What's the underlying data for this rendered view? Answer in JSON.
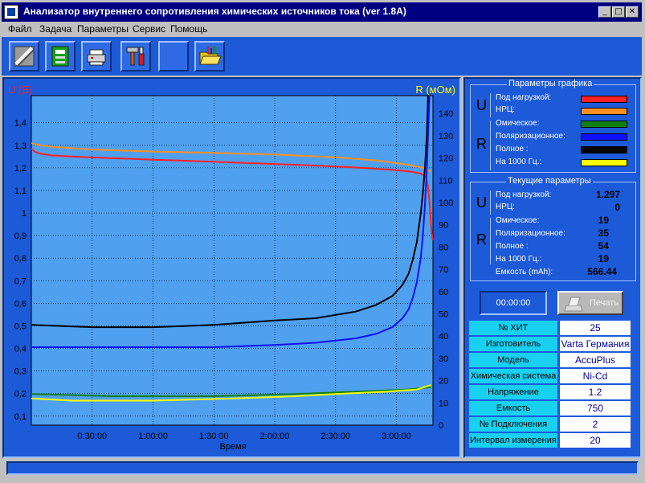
{
  "window": {
    "title": "Анализатор внутреннего сопротивления химических источников тока (ver 1.8A)"
  },
  "menu": [
    "Файл",
    "Задача",
    "Параметры",
    "Сервис",
    "Помощь"
  ],
  "toolbar_icons": [
    "battery-tool-icon",
    "circuit-board-icon",
    "printer-setup-icon",
    "tools-icon",
    "blank-tool-icon",
    "open-folder-icon"
  ],
  "chart_data": {
    "type": "line",
    "y1label": "U (В)",
    "y2label": "R (мОм)",
    "xlabel": "Время",
    "x_ticks": [
      "0:30:00",
      "1:00:00",
      "1:30:00",
      "2:00:00",
      "2:30:00",
      "3:00:00"
    ],
    "y1_ticks": [
      "0,1",
      "0,2",
      "0,3",
      "0,4",
      "0,5",
      "0,6",
      "0,7",
      "0,8",
      "0,9",
      "1",
      "1,1",
      "1,2",
      "1,3",
      "1,4"
    ],
    "y2_ticks": [
      "0",
      "10",
      "20",
      "30",
      "40",
      "50",
      "60",
      "70",
      "80",
      "90",
      "100",
      "110",
      "120",
      "130",
      "140"
    ],
    "x_unit": "minutes",
    "x_range": [
      0,
      198
    ],
    "y1_range": [
      0.06,
      1.52
    ],
    "y2_range": [
      0,
      148
    ],
    "grid": true,
    "series": [
      {
        "color": "#ff2020",
        "axis": "left",
        "points": [
          [
            0,
            1.285
          ],
          [
            2,
            1.27
          ],
          [
            5,
            1.262
          ],
          [
            10,
            1.255
          ],
          [
            20,
            1.25
          ],
          [
            30,
            1.246
          ],
          [
            45,
            1.241
          ],
          [
            60,
            1.236
          ],
          [
            75,
            1.232
          ],
          [
            90,
            1.227
          ],
          [
            105,
            1.222
          ],
          [
            120,
            1.217
          ],
          [
            135,
            1.212
          ],
          [
            150,
            1.206
          ],
          [
            165,
            1.199
          ],
          [
            180,
            1.19
          ],
          [
            188,
            1.182
          ],
          [
            192,
            1.175
          ],
          [
            194.5,
            1.16
          ],
          [
            195.5,
            1.12
          ],
          [
            196.3,
            1.05
          ],
          [
            197,
            0.95
          ],
          [
            197.8,
            0.88
          ]
        ]
      },
      {
        "color": "#ff9020",
        "axis": "left",
        "points": [
          [
            0,
            1.31
          ],
          [
            3,
            1.302
          ],
          [
            10,
            1.293
          ],
          [
            30,
            1.281
          ],
          [
            60,
            1.272
          ],
          [
            90,
            1.266
          ],
          [
            120,
            1.259
          ],
          [
            150,
            1.247
          ],
          [
            170,
            1.233
          ],
          [
            185,
            1.215
          ],
          [
            193,
            1.2
          ],
          [
            197,
            1.184
          ]
        ]
      },
      {
        "color": "#000000",
        "axis": "right",
        "points": [
          [
            0,
            45
          ],
          [
            30,
            44
          ],
          [
            60,
            44
          ],
          [
            90,
            45
          ],
          [
            120,
            47
          ],
          [
            140,
            48
          ],
          [
            160,
            51
          ],
          [
            170,
            54
          ],
          [
            178,
            58
          ],
          [
            183,
            63
          ],
          [
            186,
            68
          ],
          [
            188,
            74
          ],
          [
            190,
            82
          ],
          [
            192,
            95
          ],
          [
            193,
            104
          ],
          [
            194,
            115
          ],
          [
            195,
            130
          ],
          [
            195.6,
            148
          ]
        ]
      },
      {
        "color": "#1010ff",
        "axis": "right",
        "points": [
          [
            0,
            35
          ],
          [
            30,
            35
          ],
          [
            60,
            35
          ],
          [
            90,
            35
          ],
          [
            120,
            36
          ],
          [
            140,
            37
          ],
          [
            160,
            39
          ],
          [
            170,
            41
          ],
          [
            178,
            44
          ],
          [
            183,
            48
          ],
          [
            186,
            52
          ],
          [
            188,
            57
          ],
          [
            190,
            64
          ],
          [
            192,
            75
          ],
          [
            193,
            85
          ],
          [
            194,
            98
          ],
          [
            195,
            115
          ],
          [
            195.8,
            135
          ],
          [
            196.3,
            148
          ]
        ]
      },
      {
        "color": "#108010",
        "axis": "right",
        "points": [
          [
            0,
            14
          ],
          [
            40,
            13
          ],
          [
            90,
            13
          ],
          [
            130,
            14
          ],
          [
            160,
            15
          ],
          [
            185,
            16
          ],
          [
            197,
            17
          ]
        ]
      },
      {
        "color": "#ffff00",
        "axis": "right",
        "points": [
          [
            0,
            12
          ],
          [
            20,
            11
          ],
          [
            60,
            11
          ],
          [
            100,
            12
          ],
          [
            130,
            13
          ],
          [
            150,
            14
          ],
          [
            175,
            15
          ],
          [
            190,
            16
          ],
          [
            197,
            18
          ]
        ]
      }
    ]
  },
  "graph_params": {
    "title": "Параметры графика",
    "u_letter": "U",
    "r_letter": "R",
    "u_items": [
      {
        "label": "Под нагрузкой:",
        "color": "#ff2020"
      },
      {
        "label": "НРЦ:",
        "color": "#ff9020"
      }
    ],
    "r_items": [
      {
        "label": "Омическое:",
        "color": "#108010"
      },
      {
        "label": "Поляризационное:",
        "color": "#1010ff"
      },
      {
        "label": "Полное :",
        "color": "#000000"
      },
      {
        "label": "На 1000 Гц.:",
        "color": "#ffff00"
      }
    ]
  },
  "current_params": {
    "title": "Текущие параметры",
    "u_letter": "U",
    "r_letter": "R",
    "u_items": [
      {
        "label": "Под нагрузкой:",
        "value": "1.297"
      },
      {
        "label": "НРЦ:",
        "value": "0"
      }
    ],
    "r_items": [
      {
        "label": "Омическое:",
        "value": "19"
      },
      {
        "label": "Поляризационное:",
        "value": "35"
      },
      {
        "label": "Полное :",
        "value": "54"
      },
      {
        "label": "На 1000 Гц.:",
        "value": "19"
      }
    ],
    "capacity": {
      "label": "Емкость (mAh):",
      "value": "566.44"
    }
  },
  "timer": "00:00:00",
  "print_button": "Печать",
  "battery_info": [
    {
      "label": "№ ХИТ",
      "value": "25"
    },
    {
      "label": "Изготовитель",
      "value": "Varta Германия"
    },
    {
      "label": "Модель",
      "value": "AccuPlus"
    },
    {
      "label": "Химическая система",
      "value": "Ni-Cd"
    },
    {
      "label": "Напряжение",
      "value": "1.2"
    },
    {
      "label": "Емкость",
      "value": "750"
    },
    {
      "label": "№ Подключения",
      "value": "2"
    },
    {
      "label": "Интервал измерения",
      "value": "20"
    }
  ]
}
